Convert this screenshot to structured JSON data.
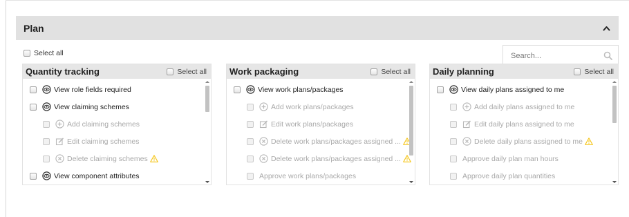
{
  "panel": {
    "title": "Plan",
    "collapse_icon": "chevron-up-icon",
    "select_all_label": "Select all",
    "search": {
      "placeholder": "Search...",
      "value": "",
      "icon": "search-icon"
    }
  },
  "columns": [
    {
      "title": "Quantity tracking",
      "select_all_label": "Select all",
      "items": [
        {
          "label": "View role fields required",
          "icon": "view-icon",
          "enabled": true,
          "warning": false
        },
        {
          "label": "View claiming schemes",
          "icon": "view-icon",
          "enabled": true,
          "warning": false
        },
        {
          "label": "Add claiming schemes",
          "icon": "add-icon",
          "enabled": false,
          "warning": false
        },
        {
          "label": "Edit claiming schemes",
          "icon": "edit-icon",
          "enabled": false,
          "warning": false
        },
        {
          "label": "Delete claiming schemes",
          "icon": "delete-icon",
          "enabled": false,
          "warning": true
        },
        {
          "label": "View component attributes",
          "icon": "view-icon",
          "enabled": true,
          "warning": false
        }
      ],
      "scroll_position": 0.0,
      "scroll_visible_fraction": 0.28
    },
    {
      "title": "Work packaging",
      "select_all_label": "Select all",
      "items": [
        {
          "label": "View work plans/packages",
          "icon": "view-icon",
          "enabled": true,
          "warning": false
        },
        {
          "label": "Add work plans/packages",
          "icon": "add-icon",
          "enabled": false,
          "warning": false
        },
        {
          "label": "Edit work plans/packages",
          "icon": "edit-icon",
          "enabled": false,
          "warning": false
        },
        {
          "label": "Delete work plans/packages assigned ...",
          "icon": "delete-icon",
          "enabled": false,
          "warning": true
        },
        {
          "label": "Delete work plans/packages assigned ...",
          "icon": "delete-icon",
          "enabled": false,
          "warning": true
        },
        {
          "label": "Approve work plans/packages",
          "icon": "",
          "enabled": false,
          "warning": false
        }
      ],
      "scroll_position": 0.0,
      "scroll_visible_fraction": 0.75
    },
    {
      "title": "Daily planning",
      "select_all_label": "Select all",
      "items": [
        {
          "label": "View daily plans assigned to me",
          "icon": "view-icon",
          "enabled": true,
          "warning": false
        },
        {
          "label": "Add daily plans assigned to me",
          "icon": "add-icon",
          "enabled": false,
          "warning": false
        },
        {
          "label": "Edit daily plans assigned to me",
          "icon": "edit-icon",
          "enabled": false,
          "warning": false
        },
        {
          "label": "Delete daily plans assigned to me",
          "icon": "delete-icon",
          "enabled": false,
          "warning": true
        },
        {
          "label": "Approve daily plan man hours",
          "icon": "",
          "enabled": false,
          "warning": false
        },
        {
          "label": "Approve daily plan quantities",
          "icon": "",
          "enabled": false,
          "warning": false
        }
      ],
      "scroll_position": 0.0,
      "scroll_visible_fraction": 0.4
    }
  ],
  "colors": {
    "header_bg": "#e1e1e1",
    "column_header_bg": "#e6e6e6",
    "warning": "#f5c518",
    "disabled_text": "#a9a9a9"
  }
}
